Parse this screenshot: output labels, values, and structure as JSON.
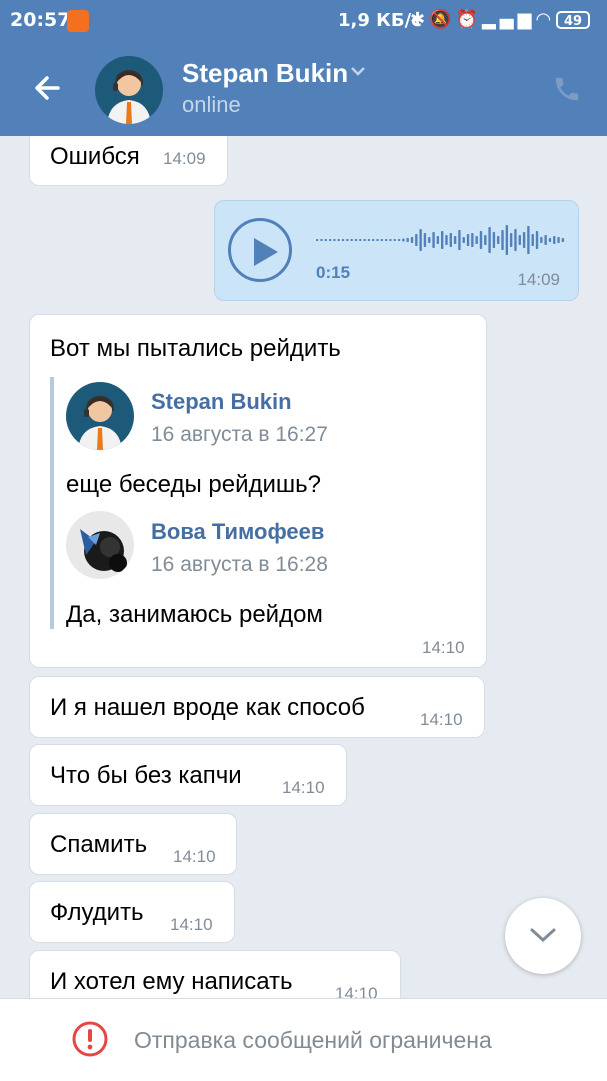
{
  "status_bar": {
    "time": "20:57",
    "speed": "1,9 КБ/с",
    "battery": "49"
  },
  "header": {
    "name": "Stepan Bukin",
    "status": "online"
  },
  "messages": [
    {
      "text": "Ошибся",
      "time": "14:09"
    },
    {
      "text": "И я нашел вроде как способ",
      "time": "14:10"
    },
    {
      "text": "Что бы без капчи",
      "time": "14:10"
    },
    {
      "text": "Спамить",
      "time": "14:10"
    },
    {
      "text": "Флудить",
      "time": "14:10"
    },
    {
      "text": "И хотел ему написать",
      "time": "14:10"
    }
  ],
  "voice": {
    "duration": "0:15",
    "time": "14:09"
  },
  "forward": {
    "text": "Вот мы пытались рейдить",
    "time": "14:10",
    "items": [
      {
        "author": "Stepan Bukin",
        "date": "16 августа в 16:27",
        "text": "еще беседы рейдишь?"
      },
      {
        "author": "Вова Тимофеев",
        "date": "16 августа в 16:28",
        "text": "Да, занимаюсь рейдом"
      }
    ]
  },
  "footer": {
    "restricted_text": "Отправка сообщений ограничена"
  },
  "colors": {
    "header": "#5181b8",
    "voice_bg": "#cce4f7",
    "accent": "#5181b8",
    "error": "#e64646"
  }
}
